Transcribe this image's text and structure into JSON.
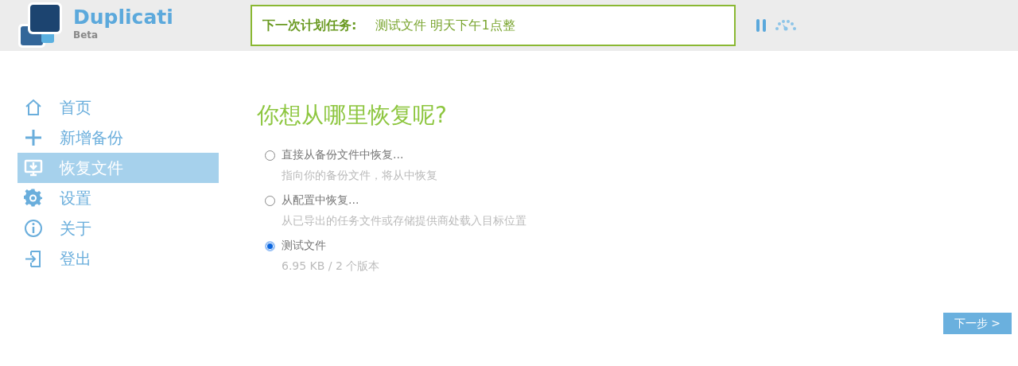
{
  "header": {
    "app_name": "Duplicati",
    "edition": "Beta",
    "schedule": {
      "label": "下一次计划任务:",
      "value": "测试文件 明天下午1点整"
    }
  },
  "sidebar": {
    "items": [
      {
        "label": "首页",
        "selected": false
      },
      {
        "label": "新增备份",
        "selected": false
      },
      {
        "label": "恢复文件",
        "selected": true
      },
      {
        "label": "设置",
        "selected": false
      },
      {
        "label": "关于",
        "selected": false
      },
      {
        "label": "登出",
        "selected": false
      }
    ]
  },
  "main": {
    "title": "你想从哪里恢复呢?",
    "options": [
      {
        "label": "直接从备份文件中恢复...",
        "description": "指向你的备份文件，将从中恢复",
        "selected": false
      },
      {
        "label": "从配置中恢复...",
        "description": "从已导出的任务文件或存储提供商处载入目标位置",
        "selected": false
      },
      {
        "label": "测试文件",
        "description": "6.95 KB / 2 个版本",
        "selected": true
      }
    ],
    "next_button": "下一步 >"
  }
}
